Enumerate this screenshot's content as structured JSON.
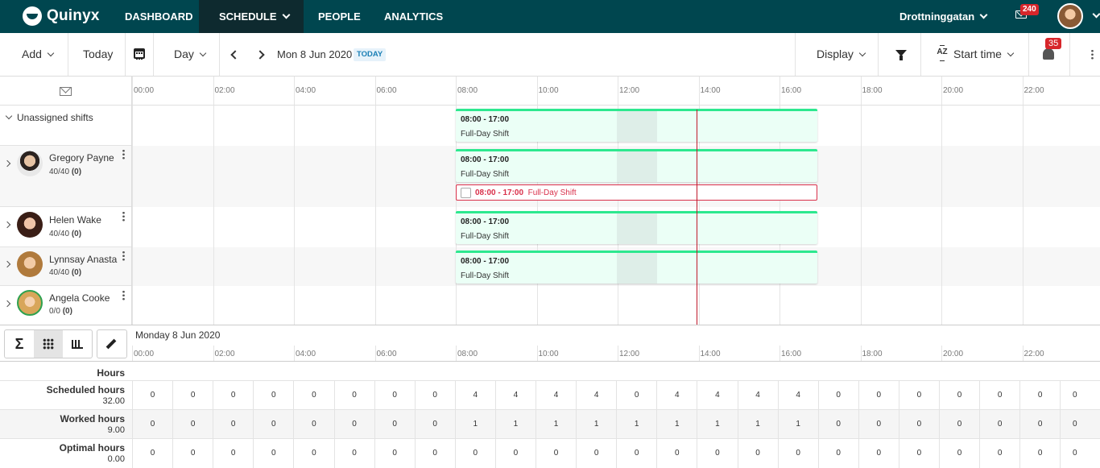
{
  "nav": {
    "logo": "Quinyx",
    "items": [
      "DASHBOARD",
      "SCHEDULE",
      "PEOPLE",
      "ANALYTICS"
    ],
    "active": "SCHEDULE",
    "site": "Drottninggatan",
    "mail_badge": "240"
  },
  "toolbar": {
    "add": "Add",
    "today": "Today",
    "view": "Day",
    "date": "Mon 8 Jun 2020",
    "today_tag": "TODAY",
    "display": "Display",
    "sort": "Start time",
    "sort_icon_text": "AZ",
    "bell_badge": "35"
  },
  "timeline": {
    "ticks": [
      "00:00",
      "02:00",
      "04:00",
      "06:00",
      "08:00",
      "10:00",
      "12:00",
      "14:00",
      "16:00",
      "18:00",
      "20:00",
      "22:00"
    ]
  },
  "schedule": {
    "unassigned_label": "Unassigned shifts",
    "unassigned_shift": {
      "time": "08:00 - 17:00",
      "name": "Full-Day Shift"
    },
    "employees": [
      {
        "name": "Gregory Payne",
        "hours": "40/40",
        "extra": "(0)",
        "shift_time": "08:00 - 17:00",
        "shift_name": "Full-Day Shift"
      },
      {
        "name": "Helen Wake",
        "hours": "40/40",
        "extra": "(0)",
        "shift_time": "08:00 - 17:00",
        "shift_name": "Full-Day Shift"
      },
      {
        "name": "Lynnsay Anasta",
        "hours": "40/40",
        "extra": "(0)",
        "shift_time": "08:00 - 17:00",
        "shift_name": "Full-Day Shift"
      },
      {
        "name": "Angela Cooke",
        "hours": "0/0",
        "extra": "(0)"
      }
    ],
    "alert_shift": {
      "time": "08:00 - 17:00",
      "name": "Full-Day Shift"
    }
  },
  "bottom": {
    "sigma": "Σ",
    "day_label": "Monday 8 Jun 2020",
    "hours_title": "Hours",
    "rows": [
      {
        "name": "Scheduled hours",
        "total": "32.00",
        "values": [
          "0",
          "0",
          "0",
          "0",
          "0",
          "0",
          "0",
          "0",
          "4",
          "4",
          "4",
          "4",
          "0",
          "4",
          "4",
          "4",
          "4",
          "0",
          "0",
          "0",
          "0",
          "0",
          "0",
          "0"
        ]
      },
      {
        "name": "Worked hours",
        "total": "9.00",
        "values": [
          "0",
          "0",
          "0",
          "0",
          "0",
          "0",
          "0",
          "0",
          "1",
          "1",
          "1",
          "1",
          "1",
          "1",
          "1",
          "1",
          "1",
          "0",
          "0",
          "0",
          "0",
          "0",
          "0",
          "0"
        ]
      },
      {
        "name": "Optimal hours",
        "total": "0.00",
        "values": [
          "0",
          "0",
          "0",
          "0",
          "0",
          "0",
          "0",
          "0",
          "0",
          "0",
          "0",
          "0",
          "0",
          "0",
          "0",
          "0",
          "0",
          "0",
          "0",
          "0",
          "0",
          "0",
          "0",
          "0"
        ]
      }
    ]
  },
  "colors": {
    "nav_bg": "#00464f",
    "shift_top": "#2de88f",
    "alert": "#d9304a",
    "now_line": "#c0182a"
  }
}
